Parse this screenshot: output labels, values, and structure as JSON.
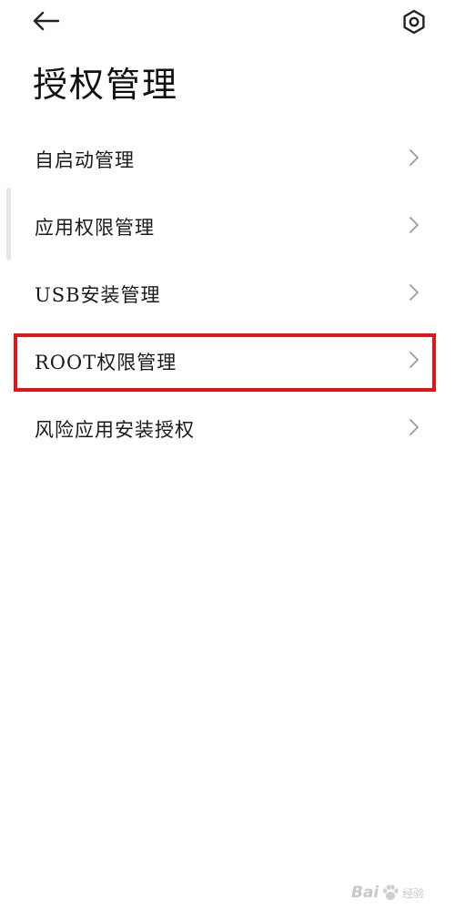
{
  "header": {
    "back_icon": "back-arrow-icon",
    "settings_icon": "gear-icon",
    "title": "授权管理"
  },
  "menu": {
    "items": [
      {
        "label": "自启动管理"
      },
      {
        "label": "应用权限管理"
      },
      {
        "label": "USB安装管理"
      },
      {
        "label": "ROOT权限管理"
      },
      {
        "label": "风险应用安装授权"
      }
    ],
    "highlighted_index": 3
  },
  "colors": {
    "highlight": "#e1141b",
    "chevron": "#9a9a9a",
    "watermark": "#c8c8c8"
  },
  "watermark": {
    "brand": "Bai",
    "suffix": "经验"
  }
}
